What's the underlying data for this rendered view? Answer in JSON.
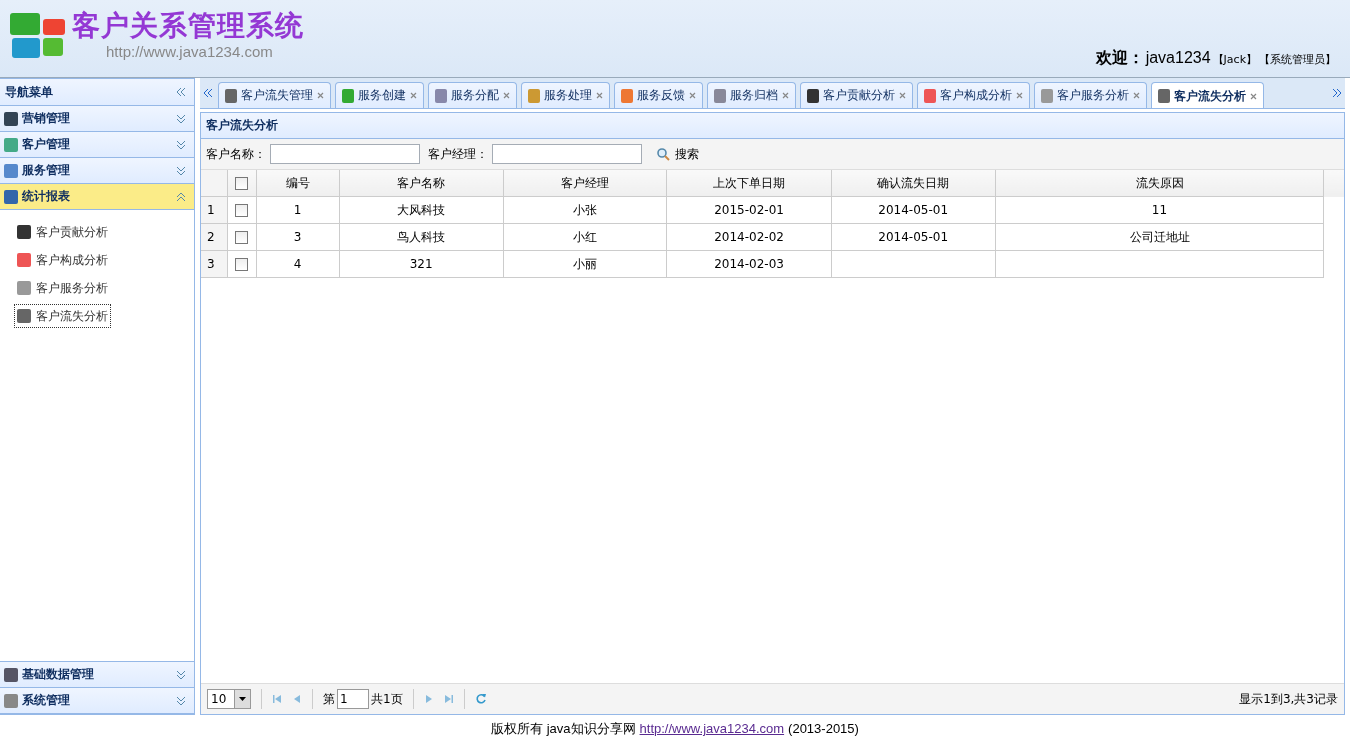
{
  "header": {
    "title": "客户关系管理系统",
    "url": "http://www.java1234.com",
    "welcome": "欢迎：",
    "user": "java1234",
    "name": "【Jack】",
    "role": "【系统管理员】"
  },
  "sidebar": {
    "title": "导航菜单",
    "sections": [
      {
        "label": "营销管理",
        "kind": "marketing",
        "expanded": false
      },
      {
        "label": "客户管理",
        "kind": "customer",
        "expanded": false
      },
      {
        "label": "服务管理",
        "kind": "service",
        "expanded": false
      },
      {
        "label": "统计报表",
        "kind": "report",
        "expanded": true,
        "items": [
          {
            "label": "客户贡献分析",
            "kind": "contribution",
            "selected": false
          },
          {
            "label": "客户构成分析",
            "kind": "structure",
            "selected": false
          },
          {
            "label": "客户服务分析",
            "kind": "person",
            "selected": false
          },
          {
            "label": "客户流失分析",
            "kind": "loss",
            "selected": true
          }
        ]
      },
      {
        "label": "基础数据管理",
        "kind": "data",
        "expanded": false
      },
      {
        "label": "系统管理",
        "kind": "system",
        "expanded": false
      }
    ]
  },
  "tabs": [
    {
      "label": "客户流失管理",
      "kind": "loss",
      "selected": false
    },
    {
      "label": "服务创建",
      "kind": "create",
      "selected": false
    },
    {
      "label": "服务分配",
      "kind": "assign",
      "selected": false
    },
    {
      "label": "服务处理",
      "kind": "process",
      "selected": false
    },
    {
      "label": "服务反馈",
      "kind": "feedback",
      "selected": false
    },
    {
      "label": "服务归档",
      "kind": "archive",
      "selected": false
    },
    {
      "label": "客户贡献分析",
      "kind": "contribution",
      "selected": false
    },
    {
      "label": "客户构成分析",
      "kind": "structure",
      "selected": false
    },
    {
      "label": "客户服务分析",
      "kind": "person",
      "selected": false
    },
    {
      "label": "客户流失分析",
      "kind": "loss",
      "selected": true
    }
  ],
  "panel": {
    "title": "客户流失分析",
    "search": {
      "fields": [
        {
          "label": "客户名称："
        },
        {
          "label": "客户经理："
        }
      ],
      "button": "搜索"
    },
    "table": {
      "all_checked": false,
      "columns": [
        "编号",
        "客户名称",
        "客户经理",
        "上次下单日期",
        "确认流失日期",
        "流失原因"
      ],
      "rows": [
        {
          "number": "1",
          "checked": false,
          "cells": [
            "1",
            "大风科技",
            "小张",
            "2015-02-01",
            "2014-05-01",
            "11"
          ]
        },
        {
          "number": "2",
          "checked": false,
          "cells": [
            "3",
            "鸟人科技",
            "小红",
            "2014-02-02",
            "2014-05-01",
            "公司迁地址"
          ]
        },
        {
          "number": "3",
          "checked": false,
          "cells": [
            "4",
            "321",
            "小丽",
            "2014-02-03",
            "",
            ""
          ]
        }
      ]
    },
    "pager": {
      "page_size": "10",
      "page_prefix": "第",
      "page": "1",
      "total_pages": "共1页",
      "summary": "显示1到3,共3记录"
    }
  },
  "footer": {
    "text": "版权所有 java知识分享网",
    "link": "http://www.java1234.com",
    "years": "(2013-2015)"
  }
}
